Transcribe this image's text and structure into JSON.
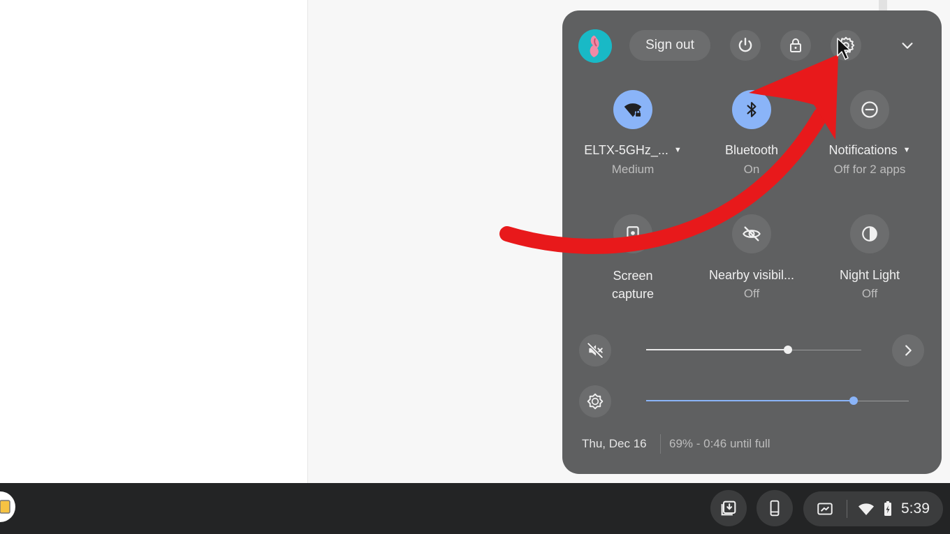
{
  "header": {
    "sign_out_label": "Sign out",
    "icons": [
      "avatar",
      "power-icon",
      "lock-icon",
      "settings-icon",
      "chevron-down-icon"
    ]
  },
  "tiles": [
    {
      "label": "ELTX-5GHz_...",
      "sub": "Medium",
      "state": "on",
      "icon": "wifi-lock-icon",
      "has_menu": true
    },
    {
      "label": "Bluetooth",
      "sub": "On",
      "state": "on",
      "icon": "bluetooth-icon",
      "has_menu": false
    },
    {
      "label": "Notifications",
      "sub": "Off for 2 apps",
      "state": "off",
      "icon": "do-not-disturb-icon",
      "has_menu": true
    },
    {
      "label": "Screen",
      "label2": "capture",
      "state": "off",
      "icon": "screen-capture-icon"
    },
    {
      "label": "Nearby visibil...",
      "sub": "Off",
      "state": "off",
      "icon": "visibility-off-icon"
    },
    {
      "label": "Night Light",
      "sub": "Off",
      "state": "off",
      "icon": "night-light-icon"
    }
  ],
  "sliders": {
    "volume": {
      "level": 0.66,
      "muted": true,
      "icon": "volume-muted-icon"
    },
    "brightness": {
      "level": 0.79,
      "icon": "brightness-icon"
    }
  },
  "footer": {
    "date": "Thu, Dec 16",
    "battery": "69% - 0:46 until full"
  },
  "shelf": {
    "time": "5:39"
  },
  "colors": {
    "panel": "#5f6061",
    "accent": "#8ab4f8",
    "annotation_arrow": "#e8191b",
    "shelf": "#232425"
  }
}
